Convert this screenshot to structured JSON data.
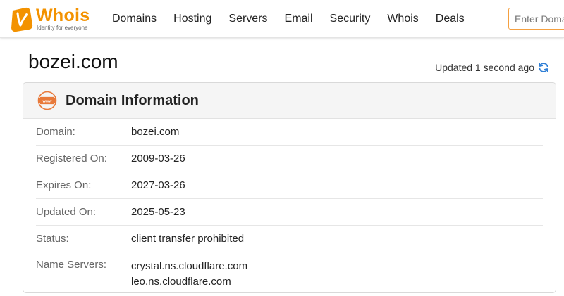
{
  "header": {
    "logo": {
      "word": "Whois",
      "tagline": "Identity for everyone"
    },
    "nav": [
      "Domains",
      "Hosting",
      "Servers",
      "Email",
      "Security",
      "Whois",
      "Deals"
    ],
    "search": {
      "placeholder": "Enter Domain",
      "value": ""
    }
  },
  "page": {
    "title": "bozei.com",
    "updated": "Updated 1 second ago"
  },
  "card": {
    "title": "Domain Information",
    "rows": [
      {
        "label": "Domain:",
        "value": "bozei.com"
      },
      {
        "label": "Registered On:",
        "value": "2009-03-26"
      },
      {
        "label": "Expires On:",
        "value": "2027-03-26"
      },
      {
        "label": "Updated On:",
        "value": "2025-05-23"
      },
      {
        "label": "Status:",
        "value": "client transfer prohibited"
      }
    ],
    "name_servers": {
      "label": "Name Servers:",
      "values": [
        "crystal.ns.cloudflare.com",
        "leo.ns.cloudflare.com"
      ]
    }
  },
  "colors": {
    "brand": "#f39200",
    "refresh": "#2f7fd6",
    "www_icon": "#e8793a"
  },
  "icons": {
    "logo": "whois-logo-icon",
    "refresh": "refresh-icon",
    "www": "www-globe-icon"
  }
}
